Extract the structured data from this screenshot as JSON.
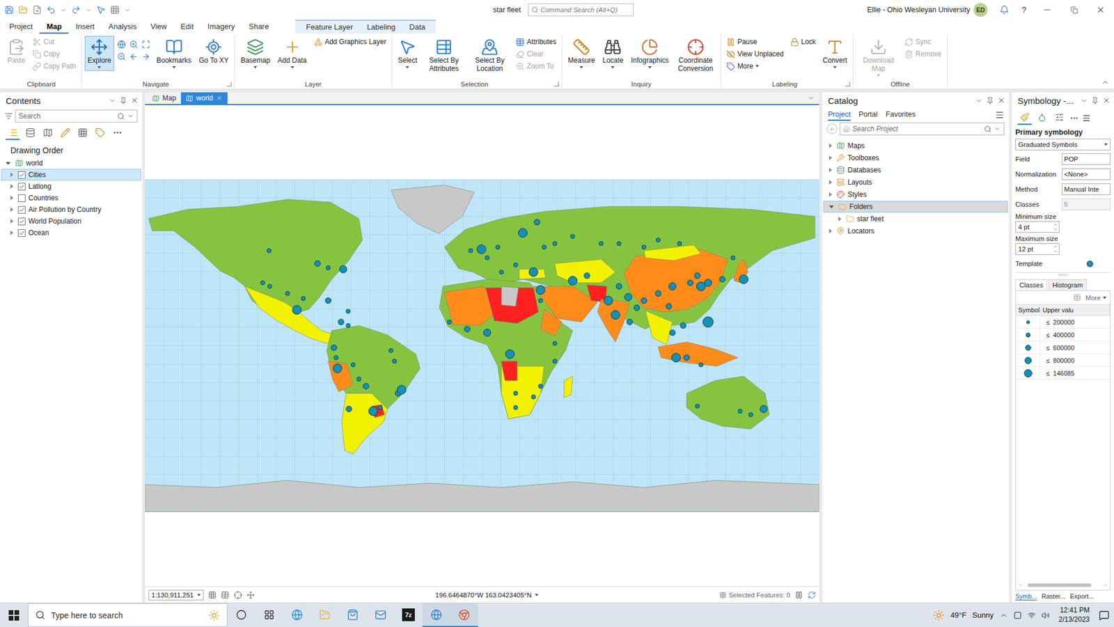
{
  "window": {
    "title": "star fleet",
    "help": "?"
  },
  "command_search": {
    "placeholder": "Command Search (Alt+Q)"
  },
  "user": {
    "name": "Ellie - Ohio Wesleyan University",
    "initials": "ED"
  },
  "ribbon_tabs": [
    {
      "label": "Project",
      "selected": false
    },
    {
      "label": "Map",
      "selected": true
    },
    {
      "label": "Insert",
      "selected": false
    },
    {
      "label": "Analysis",
      "selected": false
    },
    {
      "label": "View",
      "selected": false
    },
    {
      "label": "Edit",
      "selected": false
    },
    {
      "label": "Imagery",
      "selected": false
    },
    {
      "label": "Share",
      "selected": false
    }
  ],
  "contextual_tabs": [
    {
      "label": "Feature Layer",
      "selected": false
    },
    {
      "label": "Labeling",
      "selected": false
    },
    {
      "label": "Data",
      "selected": false
    }
  ],
  "ribbon_groups": [
    {
      "label": "Clipboard",
      "launcher": false,
      "items": [
        {
          "kind": "large",
          "label": "Paste",
          "disabled": true,
          "dropdown": false,
          "selected": false
        },
        {
          "kind": "column",
          "buttons": [
            {
              "label": "Cut",
              "disabled": true,
              "dropdown": false
            },
            {
              "label": "Copy",
              "disabled": true,
              "dropdown": false
            },
            {
              "label": "Copy Path",
              "disabled": true,
              "dropdown": false
            }
          ]
        }
      ]
    },
    {
      "label": "Navigate",
      "launcher": true,
      "items": [
        {
          "kind": "large",
          "label": "Explore",
          "disabled": false,
          "dropdown": true,
          "selected": true
        },
        {
          "kind": "icon_grid"
        },
        {
          "kind": "large",
          "label": "Bookmarks",
          "disabled": false,
          "dropdown": true,
          "selected": false
        },
        {
          "kind": "large",
          "label": "Go To XY",
          "disabled": false,
          "dropdown": false,
          "selected": false
        }
      ]
    },
    {
      "label": "Layer",
      "launcher": false,
      "items": [
        {
          "kind": "large",
          "label": "Basemap",
          "disabled": false,
          "dropdown": true,
          "selected": false
        },
        {
          "kind": "large",
          "label": "Add Data",
          "disabled": false,
          "dropdown": true,
          "selected": false
        },
        {
          "kind": "column",
          "buttons": [
            {
              "label": "Add Graphics Layer",
              "disabled": false,
              "dropdown": false
            }
          ]
        }
      ]
    },
    {
      "label": "Selection",
      "launcher": true,
      "items": [
        {
          "kind": "large",
          "label": "Select",
          "disabled": false,
          "dropdown": true,
          "selected": false
        },
        {
          "kind": "large",
          "label": "Select By Attributes",
          "disabled": false,
          "dropdown": false,
          "selected": false
        },
        {
          "kind": "large",
          "label": "Select By Location",
          "disabled": false,
          "dropdown": false,
          "selected": false
        },
        {
          "kind": "column",
          "buttons": [
            {
              "label": "Attributes",
              "disabled": false,
              "dropdown": false
            },
            {
              "label": "Clear",
              "disabled": true,
              "dropdown": false
            },
            {
              "label": "Zoom To",
              "disabled": true,
              "dropdown": false
            }
          ]
        }
      ]
    },
    {
      "label": "Inquiry",
      "launcher": false,
      "items": [
        {
          "kind": "large",
          "label": "Measure",
          "disabled": false,
          "dropdown": true,
          "selected": false
        },
        {
          "kind": "large",
          "label": "Locate",
          "disabled": false,
          "dropdown": true,
          "selected": false
        },
        {
          "kind": "large",
          "label": "Infographics",
          "disabled": false,
          "dropdown": true,
          "selected": false
        },
        {
          "kind": "large",
          "label": "Coordinate Conversion",
          "disabled": false,
          "dropdown": false,
          "selected": false
        }
      ]
    },
    {
      "label": "Labeling",
      "launcher": true,
      "items": [
        {
          "kind": "column",
          "buttons": [
            {
              "label": "Pause",
              "disabled": false,
              "dropdown": false
            },
            {
              "label": "View Unplaced",
              "disabled": false,
              "dropdown": false
            },
            {
              "label": "More",
              "disabled": false,
              "dropdown": true
            }
          ]
        },
        {
          "kind": "column",
          "buttons": [
            {
              "label": "Lock",
              "disabled": false,
              "dropdown": false
            }
          ]
        },
        {
          "kind": "large",
          "label": "Convert",
          "disabled": false,
          "dropdown": true,
          "selected": false
        }
      ]
    },
    {
      "label": "Offline",
      "launcher": false,
      "items": [
        {
          "kind": "large",
          "label": "Download Map",
          "disabled": true,
          "dropdown": true,
          "selected": false
        },
        {
          "kind": "column",
          "buttons": [
            {
              "label": "Sync",
              "disabled": true,
              "dropdown": false
            },
            {
              "label": "Remove",
              "disabled": true,
              "dropdown": false
            }
          ]
        }
      ]
    }
  ],
  "contents": {
    "title": "Contents",
    "search_placeholder": "Search",
    "view_icons": [
      {
        "selected": true
      },
      {
        "selected": false
      },
      {
        "selected": false
      },
      {
        "selected": false
      },
      {
        "selected": false
      },
      {
        "selected": false
      }
    ],
    "section": "Drawing Order",
    "map": {
      "label": "world",
      "expanded": true
    },
    "layers": [
      {
        "label": "Cities",
        "checked": true,
        "selected": true,
        "expanded": false
      },
      {
        "label": "Latlong",
        "checked": true,
        "selected": false,
        "expanded": false
      },
      {
        "label": "Countries",
        "checked": false,
        "selected": false,
        "expanded": false
      },
      {
        "label": "Air Pollution by Country",
        "checked": true,
        "selected": false,
        "expanded": false
      },
      {
        "label": "World Population",
        "checked": true,
        "selected": false,
        "expanded": false
      },
      {
        "label": "Ocean",
        "checked": true,
        "selected": false,
        "expanded": false
      }
    ]
  },
  "map_tabs": [
    {
      "label": "Map",
      "selected": false,
      "closable": false
    },
    {
      "label": "world",
      "selected": true,
      "closable": true
    }
  ],
  "map_status": {
    "scale": "1:130,911,251",
    "coordinates": "196.6464870°W 163.0423405°N",
    "selected_features": "Selected Features: 0"
  },
  "catalog": {
    "title": "Catalog",
    "tabs": [
      {
        "label": "Project",
        "selected": true
      },
      {
        "label": "Portal",
        "selected": false
      },
      {
        "label": "Favorites",
        "selected": false
      }
    ],
    "search_placeholder": "Search Project",
    "items": [
      {
        "label": "Maps",
        "expanded": false,
        "selected": false,
        "children": []
      },
      {
        "label": "Toolboxes",
        "expanded": false,
        "selected": false,
        "children": []
      },
      {
        "label": "Databases",
        "expanded": false,
        "selected": false,
        "children": []
      },
      {
        "label": "Layouts",
        "expanded": false,
        "selected": false,
        "children": []
      },
      {
        "label": "Styles",
        "expanded": false,
        "selected": false,
        "children": []
      },
      {
        "label": "Folders",
        "expanded": true,
        "selected": true,
        "children": [
          {
            "label": "star fleet",
            "expanded": false
          }
        ]
      },
      {
        "label": "Locators",
        "expanded": false,
        "selected": false,
        "children": []
      }
    ]
  },
  "symbology": {
    "title": "Symbology -...",
    "view_icons": [
      {
        "selected": true
      },
      {
        "selected": false
      },
      {
        "selected": false
      }
    ],
    "section": "Primary symbology",
    "renderer": "Graduated Symbols",
    "fields": [
      {
        "label": "Field",
        "value": "POP",
        "disabled": false
      },
      {
        "label": "Normalization",
        "value": "<None>",
        "disabled": false
      },
      {
        "label": "Method",
        "value": "Manual Inte",
        "disabled": false
      },
      {
        "label": "Classes",
        "value": "5",
        "disabled": true
      }
    ],
    "sizes": [
      {
        "label": "Minimum size",
        "value": "4 pt"
      },
      {
        "label": "Maximum size",
        "value": "12 pt"
      }
    ],
    "template": {
      "label": "Template"
    },
    "tabs": [
      {
        "label": "Classes",
        "selected": true
      },
      {
        "label": "Histogram",
        "selected": false
      }
    ],
    "more": "More",
    "columns": [
      "Symbol",
      "Upper valu"
    ],
    "classes": [
      {
        "operator": "≤",
        "value": "200000",
        "level": 0.2
      },
      {
        "operator": "≤",
        "value": "400000",
        "level": 0.4
      },
      {
        "operator": "≤",
        "value": "600000",
        "level": 0.6
      },
      {
        "operator": "≤",
        "value": "800000",
        "level": 0.8
      },
      {
        "operator": "≤",
        "value": "146085",
        "level": 1
      }
    ],
    "bottom_tabs": [
      {
        "label": "Symb...",
        "selected": true
      },
      {
        "label": "Raster...",
        "selected": false
      },
      {
        "label": "Export...",
        "selected": false
      }
    ]
  },
  "taskbar": {
    "search_placeholder": "Type here to search",
    "app_badge": "7z",
    "weather": {
      "temp": "49°F",
      "condition": "Sunny"
    },
    "time": "12:41 PM",
    "date": "2/13/2023"
  }
}
